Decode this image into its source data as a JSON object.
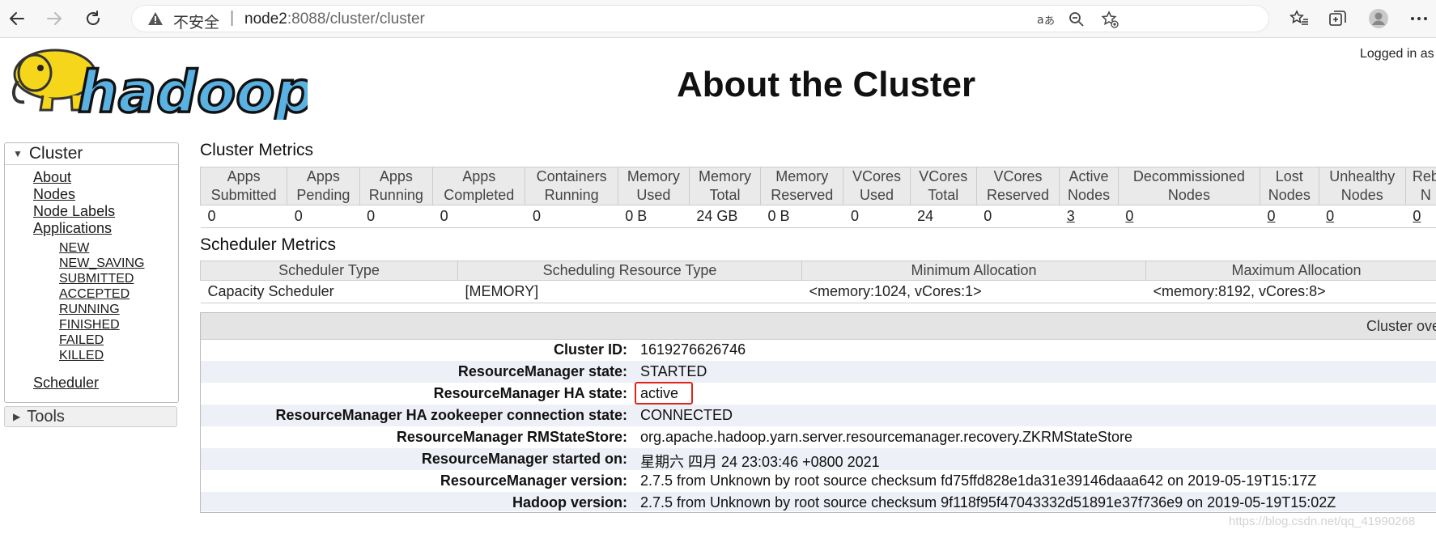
{
  "browser": {
    "insecure_label": "不安全",
    "url_host": "node2",
    "url_rest": ":8088/cluster/cluster"
  },
  "header": {
    "logged_in": "Logged in as",
    "title": "About the Cluster"
  },
  "nav": {
    "cluster_label": "Cluster",
    "links": [
      "About",
      "Nodes",
      "Node Labels",
      "Applications"
    ],
    "app_states": [
      "NEW",
      "NEW_SAVING",
      "SUBMITTED",
      "ACCEPTED",
      "RUNNING",
      "FINISHED",
      "FAILED",
      "KILLED"
    ],
    "scheduler": "Scheduler",
    "tools_label": "Tools"
  },
  "cluster_metrics": {
    "title": "Cluster Metrics",
    "headers": [
      [
        "Apps",
        "Submitted"
      ],
      [
        "Apps",
        "Pending"
      ],
      [
        "Apps",
        "Running"
      ],
      [
        "Apps",
        "Completed"
      ],
      [
        "Containers",
        "Running"
      ],
      [
        "Memory",
        "Used"
      ],
      [
        "Memory",
        "Total"
      ],
      [
        "Memory",
        "Reserved"
      ],
      [
        "VCores",
        "Used"
      ],
      [
        "VCores",
        "Total"
      ],
      [
        "VCores",
        "Reserved"
      ],
      [
        "Active",
        "Nodes"
      ],
      [
        "Decommissioned",
        "Nodes"
      ],
      [
        "Lost",
        "Nodes"
      ],
      [
        "Unhealthy",
        "Nodes"
      ],
      [
        "Reb",
        "N"
      ]
    ],
    "values": [
      "0",
      "0",
      "0",
      "0",
      "0",
      "0 B",
      "24 GB",
      "0 B",
      "0",
      "24",
      "0",
      "3",
      "0",
      "0",
      "0",
      "0"
    ]
  },
  "scheduler_metrics": {
    "title": "Scheduler Metrics",
    "headers": [
      "Scheduler Type",
      "Scheduling Resource Type",
      "Minimum Allocation",
      "Maximum Allocation"
    ],
    "values": [
      "Capacity Scheduler",
      "[MEMORY]",
      "<memory:1024, vCores:1>",
      "<memory:8192, vCores:8>"
    ]
  },
  "overview": {
    "header": "Cluster ove",
    "rows": [
      {
        "label": "Cluster ID:",
        "value": "1619276626746"
      },
      {
        "label": "ResourceManager state:",
        "value": "STARTED"
      },
      {
        "label": "ResourceManager HA state:",
        "value": "active"
      },
      {
        "label": "ResourceManager HA zookeeper connection state:",
        "value": "CONNECTED"
      },
      {
        "label": "ResourceManager RMStateStore:",
        "value": "org.apache.hadoop.yarn.server.resourcemanager.recovery.ZKRMStateStore"
      },
      {
        "label": "ResourceManager started on:",
        "value": "星期六 四月 24 23:03:46 +0800 2021"
      },
      {
        "label": "ResourceManager version:",
        "value": "2.7.5 from Unknown by root source checksum fd75ffd828e1da31e39146daaa642 on 2019-05-19T15:17Z"
      },
      {
        "label": "Hadoop version:",
        "value": "2.7.5 from Unknown by root source checksum 9f118f95f47043332d51891e37f736e9 on 2019-05-19T15:02Z"
      }
    ]
  },
  "watermark": "https://blog.csdn.net/qq_41990268",
  "colors": {
    "highlight_box": "#e0241b",
    "table_header_bg": "#eaeaea",
    "alt_row_bg": "#eef0f7",
    "logo_yellow": "#f5d61a",
    "logo_blue": "#5ab2e3"
  }
}
